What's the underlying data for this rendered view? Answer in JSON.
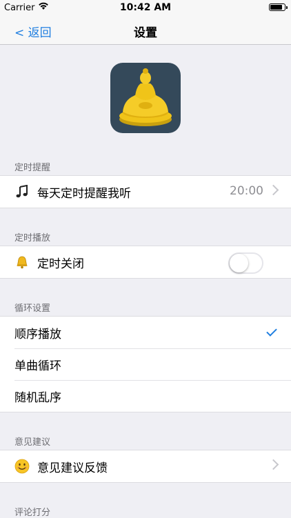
{
  "status": {
    "carrier": "Carrier",
    "time": "10:42 AM",
    "battery_level": 0.85
  },
  "nav": {
    "back": "< 返回",
    "title": "设置"
  },
  "sections": [
    {
      "header": "定时提醒",
      "rows": [
        {
          "label": "每天定时提醒我听",
          "detail": "20:00",
          "icon": "music-note-icon"
        }
      ]
    },
    {
      "header": "定时播放",
      "rows": [
        {
          "label": "定时关闭",
          "icon": "bell-icon",
          "toggle_on": false
        }
      ]
    },
    {
      "header": "循环设置",
      "rows": [
        {
          "label": "顺序播放",
          "checked": true
        },
        {
          "label": "单曲循环"
        },
        {
          "label": "随机乱序"
        }
      ]
    },
    {
      "header": "意见建议",
      "rows": [
        {
          "label": "意见建议反馈",
          "icon": "smiley-icon"
        }
      ]
    },
    {
      "header": "评论打分",
      "rows": []
    }
  ],
  "colors": {
    "accent": "#1f7ee0",
    "logo_bg": "#34495a",
    "buddha": "#f0c419"
  }
}
